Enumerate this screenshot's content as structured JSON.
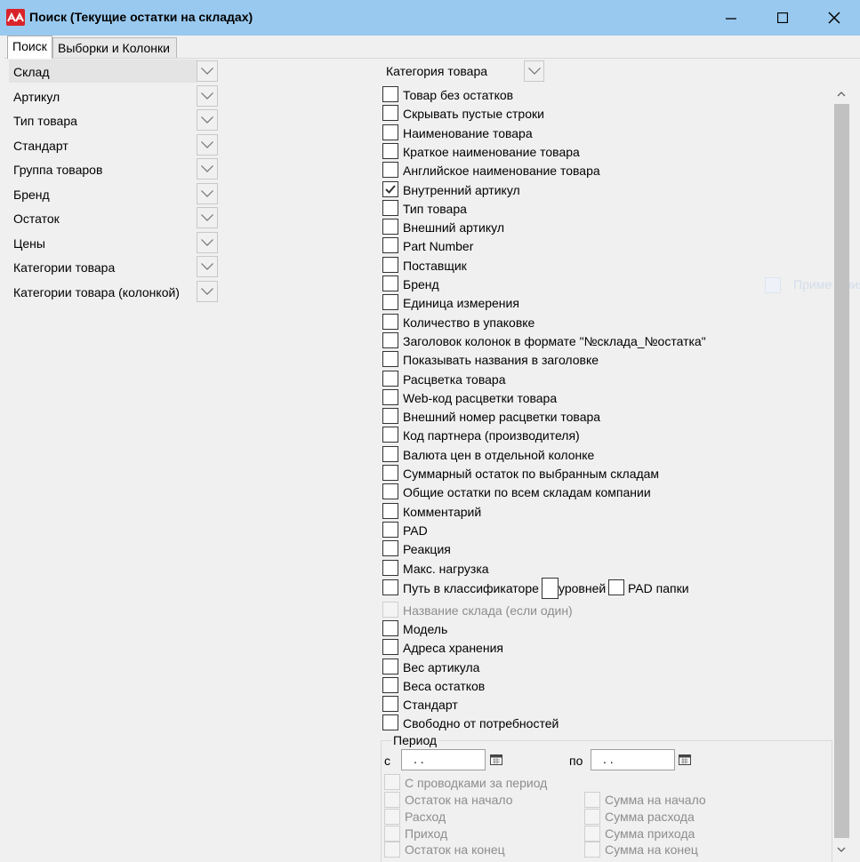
{
  "window": {
    "title": "Поиск (Текущие остатки на складах)"
  },
  "tabs": [
    {
      "label": "Поиск",
      "active": true
    },
    {
      "label": "Выборки и Колонки",
      "active": false
    }
  ],
  "filters": [
    {
      "label": "Склад"
    },
    {
      "label": "Артикул"
    },
    {
      "label": "Тип товара"
    },
    {
      "label": "Стандарт"
    },
    {
      "label": "Группа товаров"
    },
    {
      "label": "Бренд"
    },
    {
      "label": "Остаток"
    },
    {
      "label": "Цены"
    },
    {
      "label": "Категории товара"
    },
    {
      "label": "Категории товара (колонкой)"
    }
  ],
  "category": {
    "label": "Категория товара"
  },
  "options": [
    {
      "label": "Товар без остатков",
      "checked": false,
      "enabled": true
    },
    {
      "label": "Скрывать пустые строки",
      "checked": false,
      "enabled": true
    },
    {
      "label": "Наименование товара",
      "checked": false,
      "enabled": true
    },
    {
      "label": "Краткое наименование товара",
      "checked": false,
      "enabled": true
    },
    {
      "label": "Английское наименование товара",
      "checked": false,
      "enabled": true
    },
    {
      "label": "Внутренний артикул",
      "checked": true,
      "enabled": true
    },
    {
      "label": "Тип товара",
      "checked": false,
      "enabled": true
    },
    {
      "label": "Внешний артикул",
      "checked": false,
      "enabled": true
    },
    {
      "label": "Part Number",
      "checked": false,
      "enabled": true
    },
    {
      "label": "Поставщик",
      "checked": false,
      "enabled": true
    },
    {
      "label": "Бренд",
      "checked": false,
      "enabled": true
    },
    {
      "label": "Единица измерения",
      "checked": false,
      "enabled": true
    },
    {
      "label": "Количество в упаковке",
      "checked": false,
      "enabled": true
    },
    {
      "label": "Заголовок колонок в формате \"№склада_№остатка\"",
      "checked": false,
      "enabled": true
    },
    {
      "label": "Показывать названия в заголовке",
      "checked": false,
      "enabled": true
    },
    {
      "label": "Расцветка товара",
      "checked": false,
      "enabled": true
    },
    {
      "label": "Web-код расцветки товара",
      "checked": false,
      "enabled": true
    },
    {
      "label": "Внешний номер расцветки товара",
      "checked": false,
      "enabled": true
    },
    {
      "label": "Код партнера (производителя)",
      "checked": false,
      "enabled": true
    },
    {
      "label": "Валюта цен в отдельной колонке",
      "checked": false,
      "enabled": true
    },
    {
      "label": "Суммарный остаток по выбранным складам",
      "checked": false,
      "enabled": true
    },
    {
      "label": "Общие остатки по всем складам компании",
      "checked": false,
      "enabled": true
    },
    {
      "label": "Комментарий",
      "checked": false,
      "enabled": true
    },
    {
      "label": "PAD",
      "checked": false,
      "enabled": true
    },
    {
      "label": "Реакция",
      "checked": false,
      "enabled": true
    },
    {
      "label": "Макс. нагрузка",
      "checked": false,
      "enabled": true
    }
  ],
  "classifier_row": {
    "path_label": "Путь в классификаторе",
    "levels_label": "уровней",
    "pad_folders_label": "PAD папки"
  },
  "options_after": [
    {
      "label": "Название склада (если один)",
      "checked": false,
      "enabled": false
    },
    {
      "label": "Модель",
      "checked": false,
      "enabled": true
    },
    {
      "label": "Адреса хранения",
      "checked": false,
      "enabled": true
    },
    {
      "label": "Вес артикула",
      "checked": false,
      "enabled": true
    },
    {
      "label": "Веса остатков",
      "checked": false,
      "enabled": true
    },
    {
      "label": "Стандарт",
      "checked": false,
      "enabled": true
    },
    {
      "label": "Свободно от потребностей",
      "checked": false,
      "enabled": true
    }
  ],
  "period": {
    "title": "Период",
    "from_label": "с",
    "to_label": "по",
    "from_value": ". .",
    "to_value": ". .",
    "with_postings": "С проводками за период",
    "left": [
      "Остаток на начало",
      "Расход",
      "Приход",
      "Остаток на конец"
    ],
    "right": [
      "Сумма на начало",
      "Сумма расхода",
      "Сумма прихода",
      "Сумма на конец"
    ]
  },
  "ghost": {
    "label": "Примечания"
  },
  "colors": {
    "titlebar": "#99c9ef",
    "icon": "#d9232a",
    "scroll_thumb": "#c1c1c1"
  }
}
